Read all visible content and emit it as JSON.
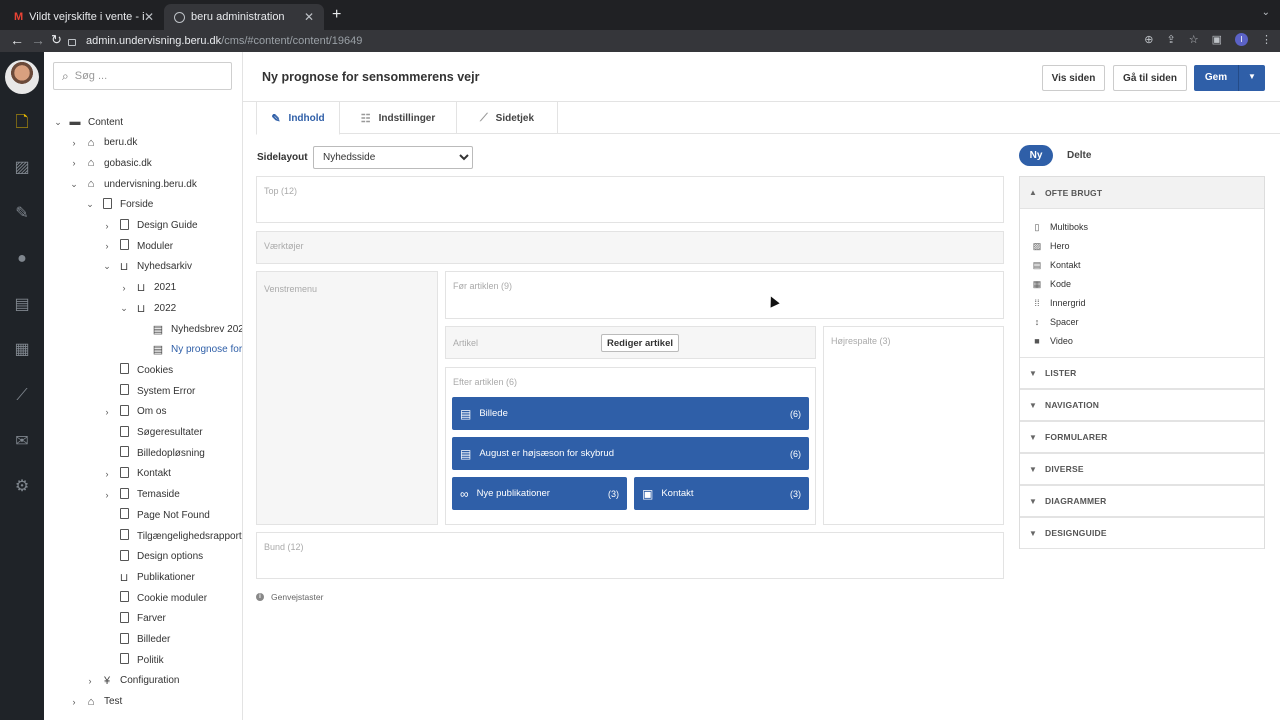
{
  "browser": {
    "tabs": [
      {
        "title": "Vildt vejrskifte i vente - ida@be",
        "icon": "gmail-icon"
      },
      {
        "title": "beru administration",
        "icon": "globe-icon"
      }
    ],
    "url_host": "admin.undervisning.beru.dk",
    "url_path": "/cms/#content/content/19649",
    "profile_initial": "I"
  },
  "search": {
    "placeholder": "Søg ..."
  },
  "tree": [
    {
      "label": "Content",
      "icon": "folder-icon",
      "caret": "⌄",
      "level": 0
    },
    {
      "label": "beru.dk",
      "icon": "home-icon",
      "caret": "›",
      "level": 1
    },
    {
      "label": "gobasic.dk",
      "icon": "home-icon",
      "caret": "›",
      "level": 1
    },
    {
      "label": "undervisning.beru.dk",
      "icon": "home-icon",
      "caret": "⌄",
      "level": 1
    },
    {
      "label": "Forside",
      "icon": "page-icon",
      "caret": "⌄",
      "level": 2
    },
    {
      "label": "Design Guide",
      "icon": "page-icon",
      "caret": "›",
      "level": 3
    },
    {
      "label": "Moduler",
      "icon": "page-icon",
      "caret": "›",
      "level": 3
    },
    {
      "label": "Nyhedsarkiv",
      "icon": "inbox-icon",
      "caret": "⌄",
      "level": 3
    },
    {
      "label": "2021",
      "icon": "inbox-icon",
      "caret": "›",
      "level": 4
    },
    {
      "label": "2022",
      "icon": "inbox-icon",
      "caret": "⌄",
      "level": 4
    },
    {
      "label": "Nyhedsbrev 202",
      "icon": "newspaper-icon",
      "caret": "",
      "level": 5
    },
    {
      "label": "Ny prognose for",
      "icon": "newspaper-icon",
      "caret": "",
      "level": 5,
      "selected": true
    },
    {
      "label": "Cookies",
      "icon": "page-icon",
      "caret": "",
      "level": 3
    },
    {
      "label": "System Error",
      "icon": "page-icon",
      "caret": "",
      "level": 3
    },
    {
      "label": "Om os",
      "icon": "page-icon",
      "caret": "›",
      "level": 3
    },
    {
      "label": "Søgeresultater",
      "icon": "page-icon",
      "caret": "",
      "level": 3
    },
    {
      "label": "Billedopløsning",
      "icon": "page-icon",
      "caret": "",
      "level": 3
    },
    {
      "label": "Kontakt",
      "icon": "page-icon",
      "caret": "›",
      "level": 3
    },
    {
      "label": "Temaside",
      "icon": "page-icon",
      "caret": "›",
      "level": 3
    },
    {
      "label": "Page Not Found",
      "icon": "page-icon",
      "caret": "",
      "level": 3
    },
    {
      "label": "Tilgængelighedsrapport",
      "icon": "page-icon",
      "caret": "",
      "level": 3
    },
    {
      "label": "Design options",
      "icon": "page-icon",
      "caret": "",
      "level": 3
    },
    {
      "label": "Publikationer",
      "icon": "inbox-icon",
      "caret": "",
      "level": 3
    },
    {
      "label": "Cookie moduler",
      "icon": "page-icon",
      "caret": "",
      "level": 3
    },
    {
      "label": "Farver",
      "icon": "page-icon",
      "caret": "",
      "level": 3
    },
    {
      "label": "Billeder",
      "icon": "page-icon",
      "caret": "",
      "level": 3
    },
    {
      "label": "Politik",
      "icon": "page-icon",
      "caret": "",
      "level": 3
    },
    {
      "label": "Configuration",
      "icon": "config-icon",
      "caret": "›",
      "level": 2
    },
    {
      "label": "Test",
      "icon": "home-icon",
      "caret": "›",
      "level": 1
    }
  ],
  "header": {
    "title": "Ny prognose for sensommerens vejr",
    "view_label": "Vis siden",
    "goto_label": "Gå til siden",
    "save_label": "Gem"
  },
  "tabs": [
    {
      "label": "Indhold",
      "icon": "edit-icon"
    },
    {
      "label": "Indstillinger",
      "icon": "settings-icon"
    },
    {
      "label": "Sidetjek",
      "icon": "chart-icon"
    }
  ],
  "layout": {
    "label": "Sidelayout",
    "selected": "Nyhedsside",
    "zones": {
      "top": "Top (12)",
      "tools": "Værktøjer",
      "left_menu": "Venstremenu",
      "before_article": "Før artiklen (9)",
      "article": "Artikel",
      "right_column": "Højrespalte (3)",
      "after_article": "Efter artiklen (6)",
      "bottom": "Bund (12)"
    },
    "edit_article_label": "Rediger artikel",
    "blocks": [
      {
        "label": "Billede",
        "count": "(6)"
      },
      {
        "label": "August er højsæson for skybrud",
        "count": "(6)"
      },
      {
        "label": "Nye publikationer",
        "count": "(3)"
      },
      {
        "label": "Kontakt",
        "count": "(3)"
      }
    ],
    "shortcuts_label": "Genvejstaster"
  },
  "panel": {
    "new_label": "Ny",
    "shared_label": "Delte",
    "open_section": "OFTE BRUGT",
    "items": [
      {
        "label": "Multiboks",
        "icon": "page-icon"
      },
      {
        "label": "Hero",
        "icon": "image-icon"
      },
      {
        "label": "Kontakt",
        "icon": "contact-card-icon"
      },
      {
        "label": "Kode",
        "icon": "code-file-icon"
      },
      {
        "label": "Innergrid",
        "icon": "grid-icon"
      },
      {
        "label": "Spacer",
        "icon": "spacer-icon"
      },
      {
        "label": "Video",
        "icon": "video-icon"
      }
    ],
    "sections": [
      "LISTER",
      "NAVIGATION",
      "FORMULARER",
      "DIVERSE",
      "DIAGRAMMER",
      "DESIGNGUIDE"
    ]
  },
  "colors": {
    "accent": "#2f5fa8",
    "rail": "#1f2328",
    "rail_active": "#e6b800"
  }
}
